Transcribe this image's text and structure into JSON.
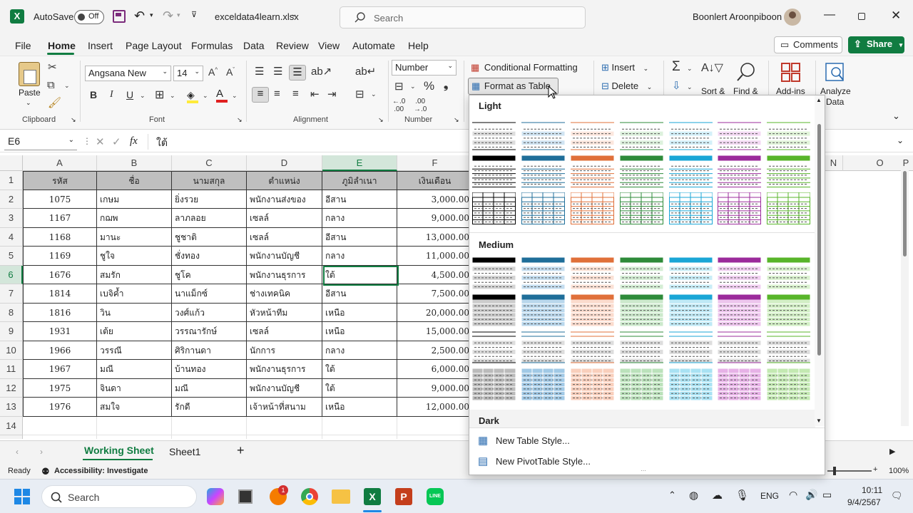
{
  "titlebar": {
    "autosave_label": "AutoSave",
    "autosave_state": "Off",
    "filename": "exceldata4learn.xlsx",
    "search_placeholder": "Search",
    "user_name": "Boonlert Aroonpiboon"
  },
  "menu": {
    "items": [
      "File",
      "Home",
      "Insert",
      "Page Layout",
      "Formulas",
      "Data",
      "Review",
      "View",
      "Automate",
      "Help"
    ],
    "active": "Home",
    "comments_label": "Comments",
    "share_label": "Share"
  },
  "ribbon": {
    "clipboard": {
      "paste_label": "Paste",
      "group_label": "Clipboard"
    },
    "font": {
      "name": "Angsana New",
      "size": "14",
      "group_label": "Font",
      "bold": "B",
      "italic": "I",
      "underline": "U"
    },
    "alignment": {
      "group_label": "Alignment"
    },
    "number": {
      "format": "Number",
      "group_label": "Number"
    },
    "styles": {
      "conditional_formatting": "Conditional Formatting",
      "format_as_table": "Format as Table"
    },
    "cells": {
      "insert": "Insert",
      "delete": "Delete"
    },
    "editing": {
      "sort_label": "Sort &",
      "find_label": "Find &"
    },
    "addins": {
      "label": "Add-ins"
    },
    "analyze": {
      "label1": "Analyze",
      "label2": "Data"
    }
  },
  "formula_bar": {
    "name_box": "E6",
    "fx": "fx",
    "content": "ใต้"
  },
  "sheet": {
    "columns": [
      "A",
      "B",
      "C",
      "D",
      "E",
      "F"
    ],
    "extra_columns": [
      "N",
      "O",
      "P"
    ],
    "rows": [
      [
        "รหัส",
        "ชื่อ",
        "นามสกุล",
        "ตำแหน่ง",
        "ภูมิลำเนา",
        "เงินเดือน"
      ],
      [
        "1075",
        "เกษม",
        "ยิ่งรวย",
        "พนักงานส่งของ",
        "อีสาน",
        "3,000.00"
      ],
      [
        "1167",
        "กฌพ",
        "ลาภลอย",
        "เซลล์",
        "กลาง",
        "9,000.00"
      ],
      [
        "1168",
        "มานะ",
        "ชูชาติ",
        "เซลล์",
        "อีสาน",
        "13,000.00"
      ],
      [
        "1169",
        "ชูใจ",
        "ชั่งทอง",
        "พนักงานบัญชี",
        "กลาง",
        "11,000.00"
      ],
      [
        "1676",
        "สมรัก",
        "ชูโค",
        "พนักงานธุรการ",
        "ใต้",
        "4,500.00"
      ],
      [
        "1814",
        "เบจิค้ำ",
        "นาแม็กซ์",
        "ช่างเทคนิค",
        "อีสาน",
        "7,500.00"
      ],
      [
        "1816",
        "วิน",
        "วงศ์แก้ว",
        "หัวหน้าทีม",
        "เหนือ",
        "20,000.00"
      ],
      [
        "1931",
        "เต้ย",
        "วรรณารักษ์",
        "เซลล์",
        "เหนือ",
        "15,000.00"
      ],
      [
        "1966",
        "วรรณี",
        "ศิริกานดา",
        "นักการ",
        "กลาง",
        "2,500.00"
      ],
      [
        "1967",
        "มณี",
        "บ้านทอง",
        "พนักงานธุรการ",
        "ใต้",
        "6,000.00"
      ],
      [
        "1975",
        "จินดา",
        "มณี",
        "พนักงานบัญชี",
        "ใต้",
        "9,000.00"
      ],
      [
        "1976",
        "สมใจ",
        "รักดี",
        "เจ้าหน้าที่สนาม",
        "เหนือ",
        "12,000.00"
      ]
    ],
    "row_numbers": [
      "1",
      "2",
      "3",
      "4",
      "5",
      "6",
      "7",
      "8",
      "9",
      "10",
      "11",
      "12",
      "13",
      "14",
      "15"
    ],
    "selected_cell": "E6"
  },
  "tabs": {
    "items": [
      "Working Sheet",
      "Sheet1"
    ],
    "active": "Working Sheet",
    "add": "+"
  },
  "status": {
    "ready": "Ready",
    "accessibility": "Accessibility: Investigate",
    "zoom": "100%"
  },
  "gallery": {
    "sections": [
      "Light",
      "Medium",
      "Dark"
    ],
    "new_table_style": "New Table Style...",
    "new_pivot_style": "New PivotTable Style...",
    "palette": [
      "#7f7f7f",
      "#4f9ad0",
      "#f4a582",
      "#7fc97f",
      "#5ec8e8",
      "#d26fd2",
      "#8fd66f"
    ],
    "palette_dark": [
      "#000000",
      "#1f6e99",
      "#e0703a",
      "#2e8b3a",
      "#1aa6d6",
      "#9b2b9b",
      "#58b52a"
    ]
  },
  "taskbar": {
    "search_placeholder": "Search",
    "time": "10:11",
    "date": "9/4/2567",
    "lang": "ENG",
    "badge": "1"
  }
}
